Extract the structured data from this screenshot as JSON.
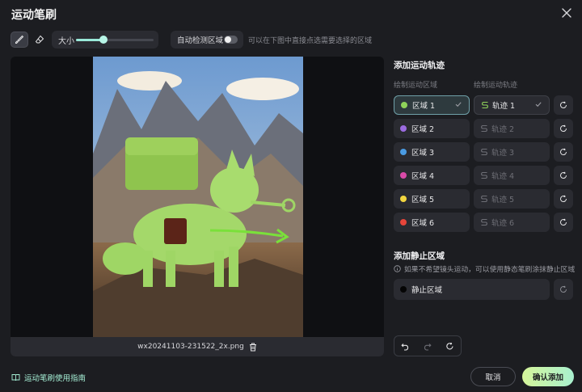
{
  "dialog": {
    "title": "运动笔刷"
  },
  "toolbar": {
    "size_label": "大小",
    "size_value": 0.35,
    "auto_detect_label": "自动检测区域",
    "auto_detect_on": false,
    "hint": "可以在下图中直接点选需要选择的区域"
  },
  "canvas": {
    "filename": "wx20241103-231522_2x.png"
  },
  "motion": {
    "title": "添加运动轨迹",
    "regions_header": "绘制运动区域",
    "tracks_header": "绘制运动轨迹",
    "regions": [
      {
        "label": "区域 1",
        "color": "#8fd35a",
        "active": true
      },
      {
        "label": "区域 2",
        "color": "#9b6be0",
        "active": false
      },
      {
        "label": "区域 3",
        "color": "#4a9be3",
        "active": false
      },
      {
        "label": "区域 4",
        "color": "#d94aa8",
        "active": false
      },
      {
        "label": "区域 5",
        "color": "#f2d640",
        "active": false
      },
      {
        "label": "区域 6",
        "color": "#e6453a",
        "active": false
      }
    ],
    "tracks": [
      {
        "label": "轨迹 1",
        "active": true
      },
      {
        "label": "轨迹 2",
        "active": false
      },
      {
        "label": "轨迹 3",
        "active": false
      },
      {
        "label": "轨迹 4",
        "active": false
      },
      {
        "label": "轨迹 5",
        "active": false
      },
      {
        "label": "轨迹 6",
        "active": false
      }
    ]
  },
  "static": {
    "title": "添加静止区域",
    "info": "如果不希望镜头运动，可以使用静态笔刷涂抹静止区域",
    "region_label": "静止区域"
  },
  "footer": {
    "guide_link": "运动笔刷使用指南",
    "cancel_label": "取消",
    "confirm_label": "确认添加"
  },
  "colors": {
    "accent": "#9ae9d9",
    "track_active": "#8fd35a"
  }
}
